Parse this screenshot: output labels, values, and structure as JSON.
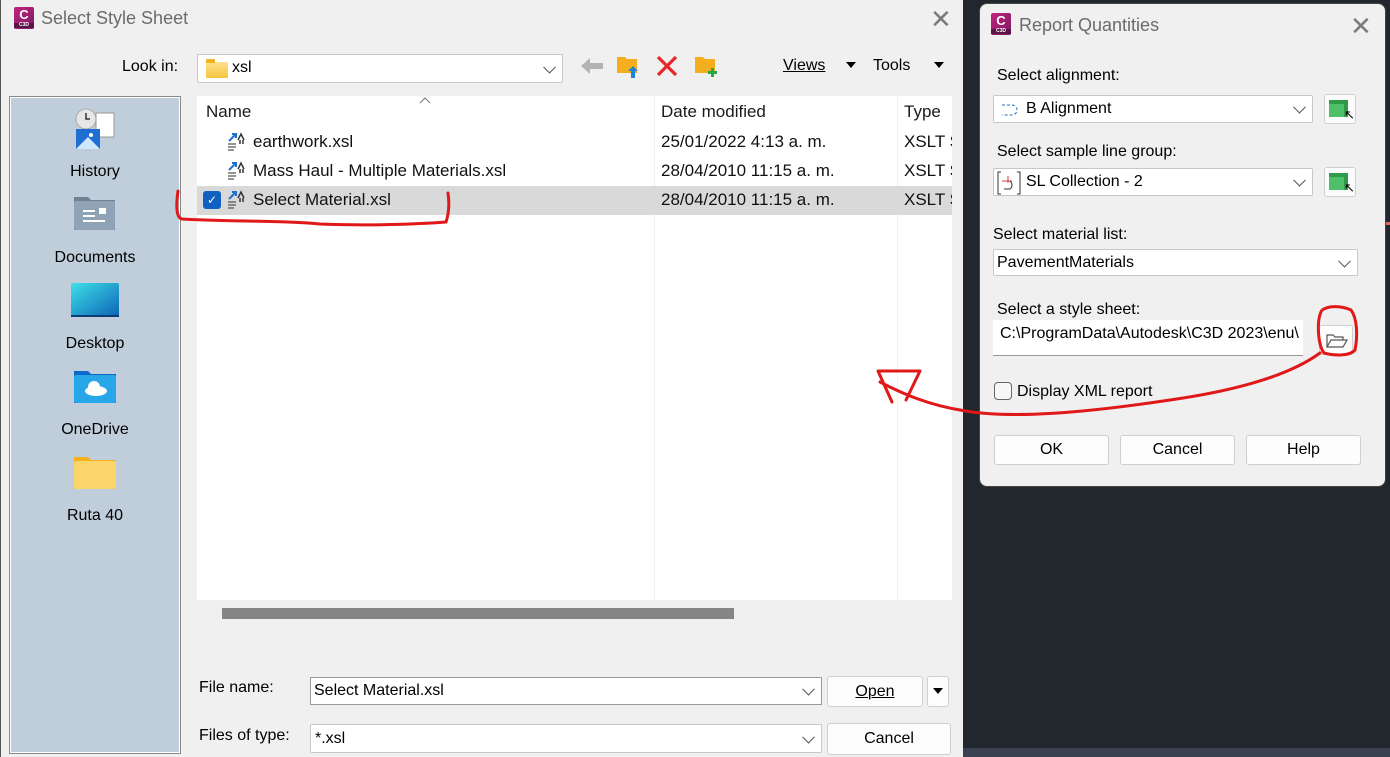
{
  "select_style_sheet": {
    "title": "Select Style Sheet",
    "app_badge": "C",
    "app_badge_sub": "C3D",
    "look_in_label": "Look in:",
    "look_in_value": "xsl",
    "toolbar": {
      "back": "back-arrow-icon",
      "up_folder": "folder-up-icon",
      "delete": "delete-icon",
      "new_folder": "new-folder-icon",
      "views_label": "Views",
      "tools_label": "Tools"
    },
    "places": [
      {
        "label": "History",
        "icon": "history-icon"
      },
      {
        "label": "Documents",
        "icon": "documents-icon"
      },
      {
        "label": "Desktop",
        "icon": "desktop-icon"
      },
      {
        "label": "OneDrive",
        "icon": "onedrive-icon"
      },
      {
        "label": "Ruta 40",
        "icon": "folder-icon"
      }
    ],
    "columns": [
      "Name",
      "Date modified",
      "Type"
    ],
    "files": [
      {
        "name": "earthwork.xsl",
        "date": "25/01/2022 4:13 a. m.",
        "type": "XSLT Stylesheet",
        "selected": false
      },
      {
        "name": "Mass Haul - Multiple Materials.xsl",
        "date": "28/04/2010 11:15 a. m.",
        "type": "XSLT Stylesheet",
        "selected": false
      },
      {
        "name": "Select Material.xsl",
        "date": "28/04/2010 11:15 a. m.",
        "type": "XSLT Stylesheet",
        "selected": true
      }
    ],
    "file_name_label": "File name:",
    "file_name_value": "Select Material.xsl",
    "files_of_type_label": "Files of type:",
    "files_of_type_value": "*.xsl",
    "open_label": "Open",
    "cancel_label": "Cancel"
  },
  "report_quantities": {
    "title": "Report Quantities",
    "app_badge": "C",
    "app_badge_sub": "C3D",
    "alignment_label": "Select alignment:",
    "alignment_value": "B Alignment",
    "sample_line_group_label": "Select sample line group:",
    "sample_line_group_value": "SL Collection - 2",
    "material_list_label": "Select material list:",
    "material_list_value": "PavementMaterials",
    "style_sheet_label": "Select a style sheet:",
    "style_sheet_value": "C:\\ProgramData\\Autodesk\\C3D 2023\\enu\\",
    "display_xml_label": "Display XML report",
    "display_xml_checked": false,
    "ok_label": "OK",
    "cancel_label": "Cancel",
    "help_label": "Help"
  },
  "colors": {
    "annotation_red": "#e01818",
    "selection_blue": "#0f62c1",
    "places_bg": "#c0cedb",
    "brand_magenta": "#b0226f"
  }
}
